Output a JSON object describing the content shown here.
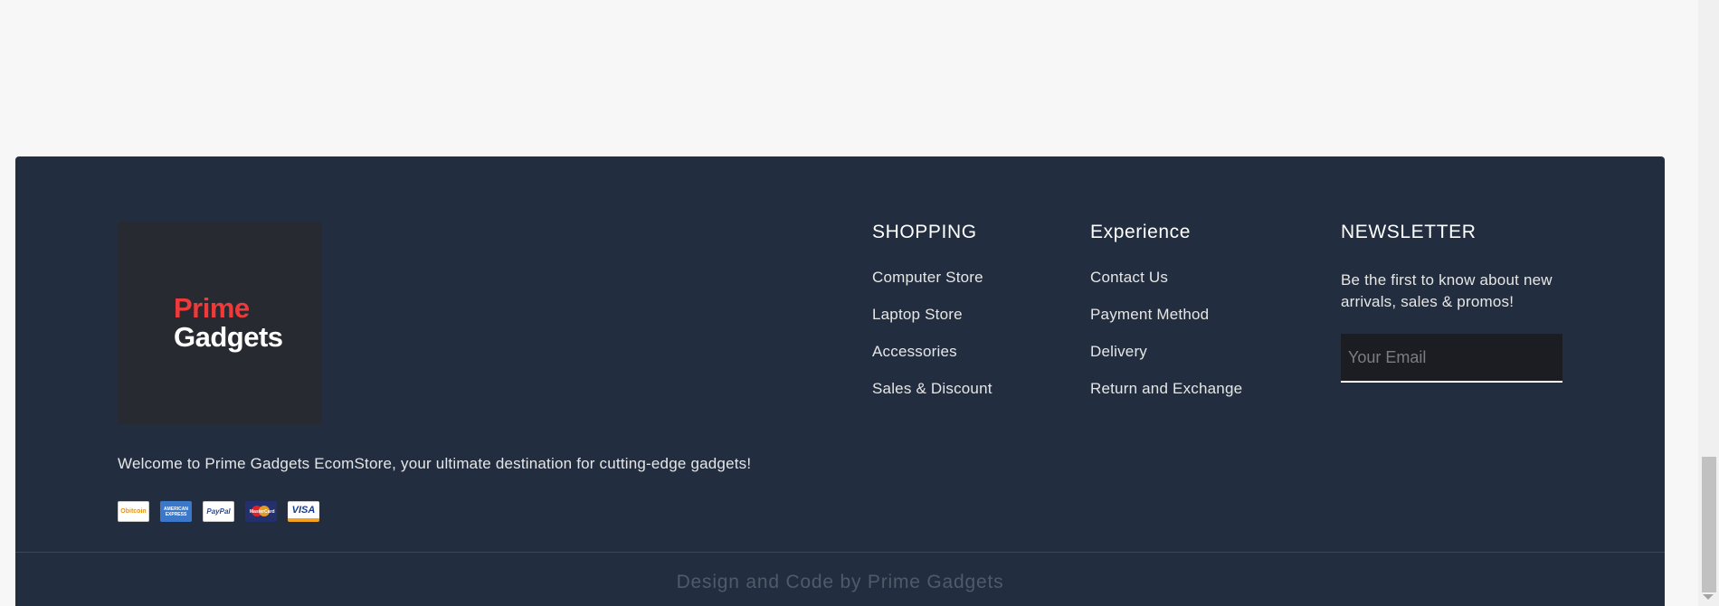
{
  "brand": {
    "logo_line1": "Prime",
    "logo_line2": "Gadgets",
    "logo_bg": "#282a31",
    "accent": "#f03a3a"
  },
  "footer": {
    "bg": "#222e3f",
    "welcome_text": "Welcome to Prime Gadgets EcomStore, your ultimate destination for cutting-edge gadgets!",
    "payment_icons": [
      {
        "name": "bitcoin-icon",
        "label": "Obitcoin"
      },
      {
        "name": "amex-icon",
        "label": "AMERICAN EXPRESS"
      },
      {
        "name": "paypal-icon",
        "label": "PayPal"
      },
      {
        "name": "mastercard-icon",
        "label": "MasterCard"
      },
      {
        "name": "visa-icon",
        "label": "VISA"
      }
    ],
    "shopping": {
      "title": "SHOPPING",
      "items": [
        "Computer Store",
        "Laptop Store",
        "Accessories",
        "Sales & Discount"
      ]
    },
    "experience": {
      "title": "Experience",
      "items": [
        "Contact Us",
        "Payment Method",
        "Delivery",
        "Return and Exchange"
      ]
    },
    "newsletter": {
      "title": "NEWSLETTER",
      "text": "Be the first to know about new arrivals, sales & promos!",
      "email_placeholder": "Your Email",
      "email_value": ""
    },
    "credit": "Design and Code by Prime Gadgets"
  }
}
